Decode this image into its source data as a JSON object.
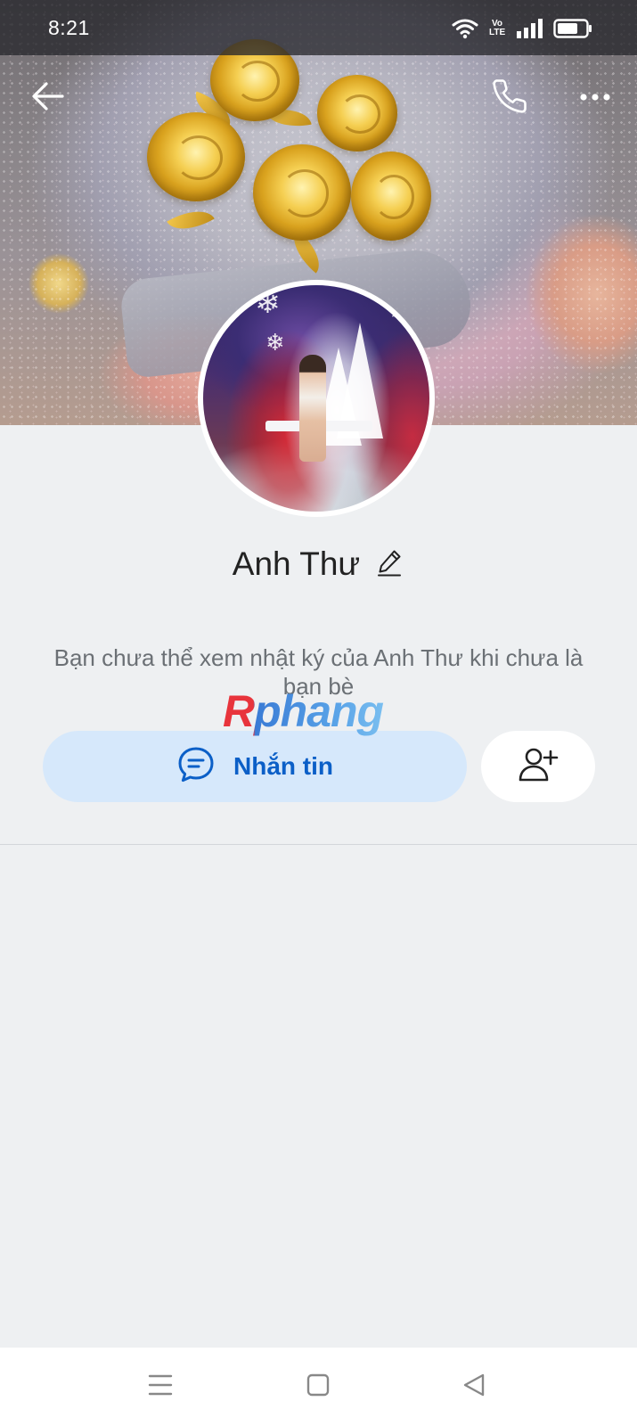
{
  "status_bar": {
    "time": "8:21",
    "volte_line1": "Vo",
    "volte_line2": "LTE"
  },
  "header": {
    "back_icon": "arrow-left-icon",
    "call_icon": "phone-icon",
    "more_icon": "more-horizontal-icon"
  },
  "profile": {
    "name": "Anh Thư",
    "edit_icon": "pencil-icon",
    "notice": "Bạn chưa thể xem nhật ký của Anh Thư khi chưa là bạn bè"
  },
  "watermark": {
    "text": "Rphang"
  },
  "actions": {
    "message_label": "Nhắn tin",
    "message_icon": "chat-bubble-icon",
    "add_friend_icon": "add-user-icon"
  },
  "nav_bar": {
    "menu_icon": "menu-icon",
    "home_icon": "square-icon",
    "back_icon": "triangle-back-icon"
  },
  "colors": {
    "background": "#eef0f2",
    "message_button_bg": "#d6e8fb",
    "message_button_text": "#0b5fc7",
    "notice_text": "#6b7075"
  }
}
